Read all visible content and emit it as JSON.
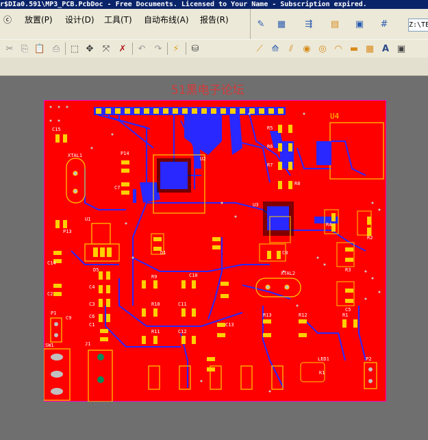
{
  "window": {
    "title": "r$DIa0.591\\MP3_PCB.PcbDoc - Free Documents. Licensed to Your Name - Subscription expired."
  },
  "menu": {
    "items": [
      "ⓒ",
      "放置(P)",
      "设计(D)",
      "工具(T)",
      "自动布线(A)",
      "报告(R)"
    ]
  },
  "toolbar": {
    "path_value": "Z:\\TE"
  },
  "watermark": {
    "text": "51黑电子论坛"
  },
  "pcb": {
    "labels": {
      "u4": "U4",
      "u2": "U2",
      "u3": "U3",
      "u1": "U1",
      "xtal1": "XTAL1",
      "xtal2": "XTAL2",
      "c15": "C15",
      "p14": "P14",
      "p13": "P13",
      "c7": "C7",
      "c14": "C14",
      "c2": "C2",
      "d5": "D5",
      "c4": "C4",
      "c3": "C3",
      "c6": "C6",
      "c1": "C1",
      "r9": "R9",
      "r10": "R10",
      "r11": "R11",
      "c10": "C10",
      "c11": "C11",
      "c12": "C12",
      "c13": "C13",
      "d1": "D1",
      "p1": "P1",
      "c9": "C9",
      "sw1": "SW1",
      "j1": "J1",
      "r5": "R5",
      "r6": "R6",
      "r7": "R7",
      "r8": "R8",
      "r4": "R4",
      "r2": "R2",
      "r3": "R3",
      "r13": "R13",
      "r12": "R12",
      "r1": "R1",
      "c8": "C8",
      "c5": "C5",
      "p2": "P2",
      "k1": "K1",
      "led1": "LED1"
    }
  }
}
